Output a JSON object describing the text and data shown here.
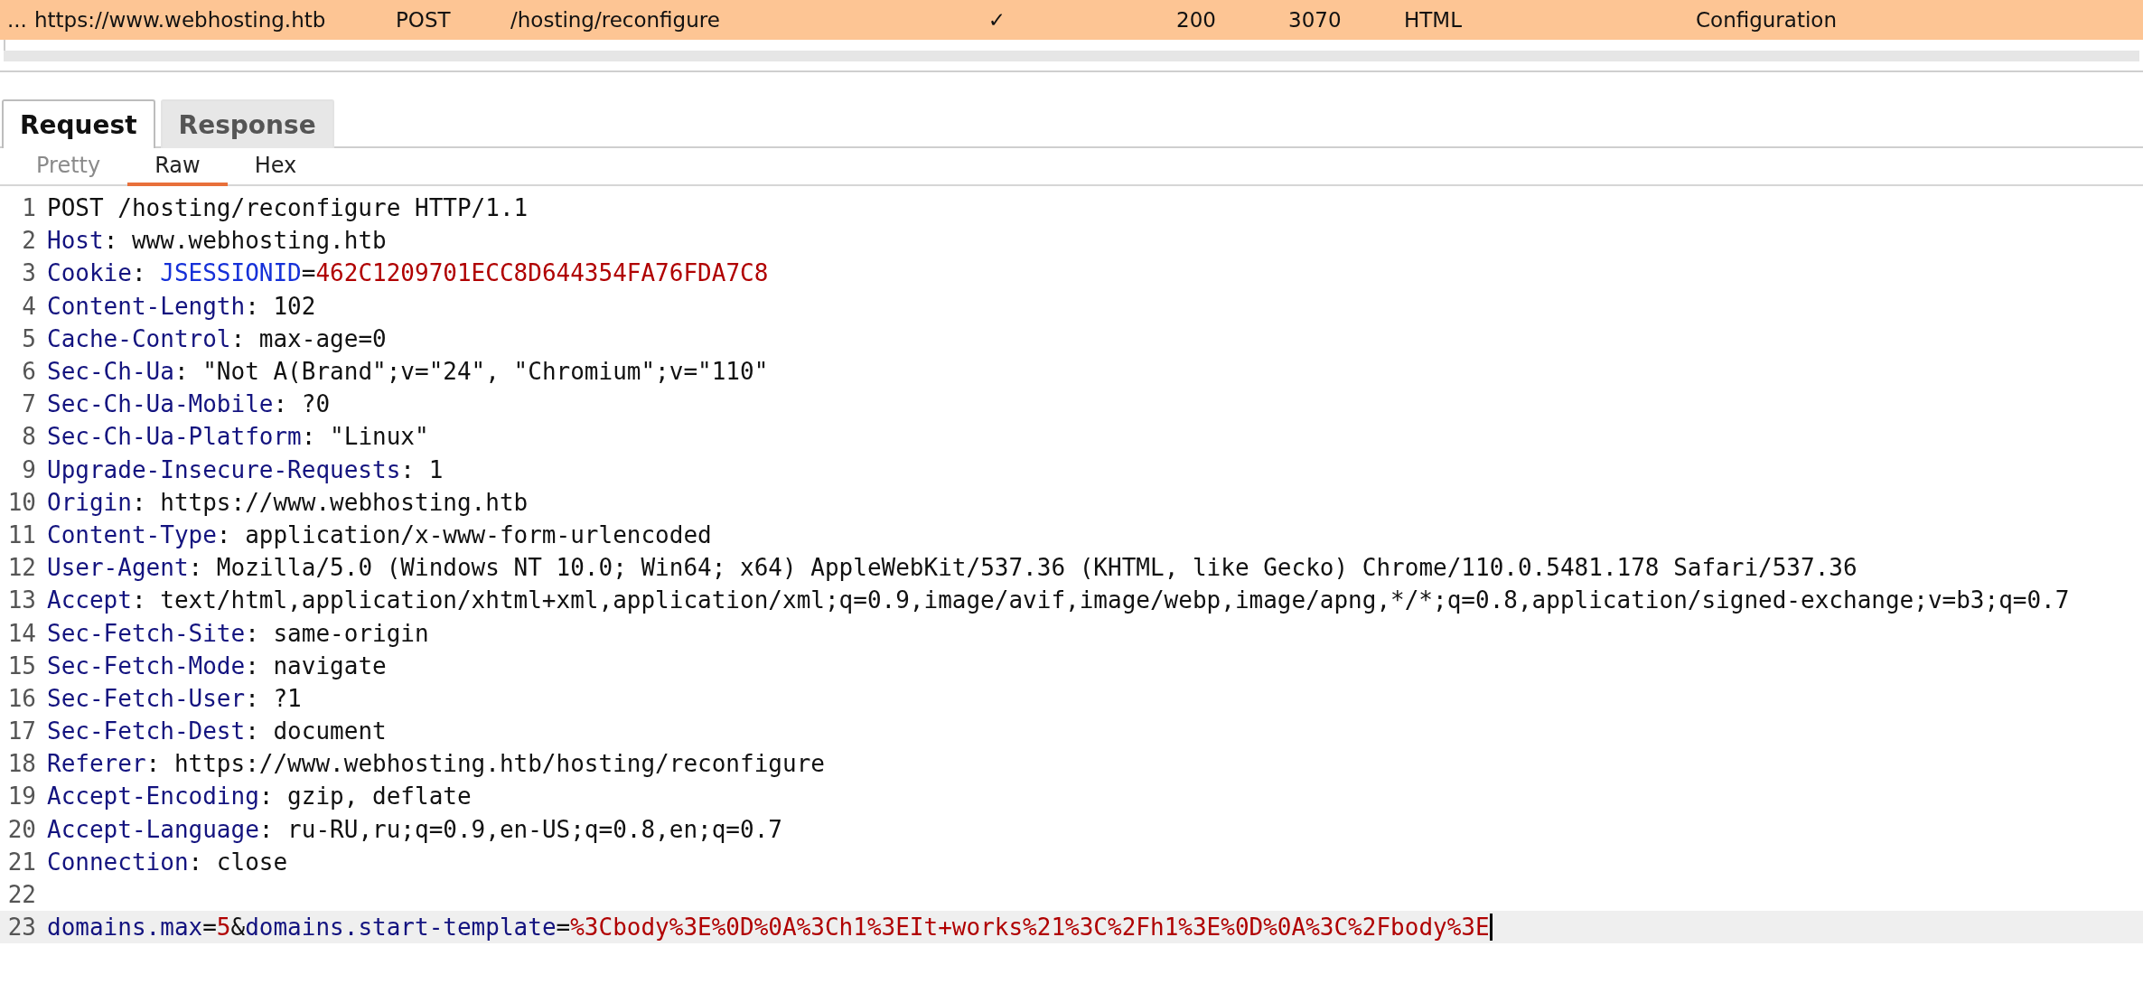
{
  "history_table": {
    "rows": [
      {
        "selected": true,
        "cells": [
          "...",
          "https://www.webhosting.htb",
          "POST",
          "/hosting/reconfigure",
          "✓",
          "200",
          "3070",
          "HTML",
          "Configuration"
        ]
      }
    ]
  },
  "message_tabs": [
    {
      "label": "Request",
      "selected": true
    },
    {
      "label": "Response",
      "selected": false
    }
  ],
  "view_tabs": [
    {
      "label": "Pretty",
      "selected": false,
      "disabled": true
    },
    {
      "label": "Raw",
      "selected": true,
      "disabled": false
    },
    {
      "label": "Hex",
      "selected": false,
      "disabled": false
    }
  ],
  "editor": {
    "lines": [
      {
        "number": "1",
        "active": false,
        "segments": [
          {
            "kind": "plain",
            "text": "POST /hosting/reconfigure HTTP/1.1"
          }
        ]
      },
      {
        "number": "2",
        "active": false,
        "segments": [
          {
            "kind": "header",
            "text": "Host"
          },
          {
            "kind": "plain",
            "text": ": www.webhosting.htb"
          }
        ]
      },
      {
        "number": "3",
        "active": false,
        "segments": [
          {
            "kind": "header",
            "text": "Cookie"
          },
          {
            "kind": "plain",
            "text": ": "
          },
          {
            "kind": "param",
            "text": "JSESSIONID"
          },
          {
            "kind": "plain",
            "text": "="
          },
          {
            "kind": "value",
            "text": "462C1209701ECC8D644354FA76FDA7C8"
          }
        ]
      },
      {
        "number": "4",
        "active": false,
        "segments": [
          {
            "kind": "header",
            "text": "Content-Length"
          },
          {
            "kind": "plain",
            "text": ": 102"
          }
        ]
      },
      {
        "number": "5",
        "active": false,
        "segments": [
          {
            "kind": "header",
            "text": "Cache-Control"
          },
          {
            "kind": "plain",
            "text": ": max-age=0"
          }
        ]
      },
      {
        "number": "6",
        "active": false,
        "segments": [
          {
            "kind": "header",
            "text": "Sec-Ch-Ua"
          },
          {
            "kind": "plain",
            "text": ": \"Not A(Brand\";v=\"24\", \"Chromium\";v=\"110\""
          }
        ]
      },
      {
        "number": "7",
        "active": false,
        "segments": [
          {
            "kind": "header",
            "text": "Sec-Ch-Ua-Mobile"
          },
          {
            "kind": "plain",
            "text": ": ?0"
          }
        ]
      },
      {
        "number": "8",
        "active": false,
        "segments": [
          {
            "kind": "header",
            "text": "Sec-Ch-Ua-Platform"
          },
          {
            "kind": "plain",
            "text": ": \"Linux\""
          }
        ]
      },
      {
        "number": "9",
        "active": false,
        "segments": [
          {
            "kind": "header",
            "text": "Upgrade-Insecure-Requests"
          },
          {
            "kind": "plain",
            "text": ": 1"
          }
        ]
      },
      {
        "number": "10",
        "active": false,
        "segments": [
          {
            "kind": "header",
            "text": "Origin"
          },
          {
            "kind": "plain",
            "text": ": https://www.webhosting.htb"
          }
        ]
      },
      {
        "number": "11",
        "active": false,
        "segments": [
          {
            "kind": "header",
            "text": "Content-Type"
          },
          {
            "kind": "plain",
            "text": ": application/x-www-form-urlencoded"
          }
        ]
      },
      {
        "number": "12",
        "active": false,
        "segments": [
          {
            "kind": "header",
            "text": "User-Agent"
          },
          {
            "kind": "plain",
            "text": ": Mozilla/5.0 (Windows NT 10.0; Win64; x64) AppleWebKit/537.36 (KHTML, like Gecko) Chrome/110.0.5481.178 Safari/537.36"
          }
        ]
      },
      {
        "number": "13",
        "active": false,
        "segments": [
          {
            "kind": "header",
            "text": "Accept"
          },
          {
            "kind": "plain",
            "text": ": text/html,application/xhtml+xml,application/xml;q=0.9,image/avif,image/webp,image/apng,*/*;q=0.8,application/signed-exchange;v=b3;q=0.7"
          }
        ]
      },
      {
        "number": "14",
        "active": false,
        "segments": [
          {
            "kind": "header",
            "text": "Sec-Fetch-Site"
          },
          {
            "kind": "plain",
            "text": ": same-origin"
          }
        ]
      },
      {
        "number": "15",
        "active": false,
        "segments": [
          {
            "kind": "header",
            "text": "Sec-Fetch-Mode"
          },
          {
            "kind": "plain",
            "text": ": navigate"
          }
        ]
      },
      {
        "number": "16",
        "active": false,
        "segments": [
          {
            "kind": "header",
            "text": "Sec-Fetch-User"
          },
          {
            "kind": "plain",
            "text": ": ?1"
          }
        ]
      },
      {
        "number": "17",
        "active": false,
        "segments": [
          {
            "kind": "header",
            "text": "Sec-Fetch-Dest"
          },
          {
            "kind": "plain",
            "text": ": document"
          }
        ]
      },
      {
        "number": "18",
        "active": false,
        "segments": [
          {
            "kind": "header",
            "text": "Referer"
          },
          {
            "kind": "plain",
            "text": ": https://www.webhosting.htb/hosting/reconfigure"
          }
        ]
      },
      {
        "number": "19",
        "active": false,
        "segments": [
          {
            "kind": "header",
            "text": "Accept-Encoding"
          },
          {
            "kind": "plain",
            "text": ": gzip, deflate"
          }
        ]
      },
      {
        "number": "20",
        "active": false,
        "segments": [
          {
            "kind": "header",
            "text": "Accept-Language"
          },
          {
            "kind": "plain",
            "text": ": ru-RU,ru;q=0.9,en-US;q=0.8,en;q=0.7"
          }
        ]
      },
      {
        "number": "21",
        "active": false,
        "segments": [
          {
            "kind": "header",
            "text": "Connection"
          },
          {
            "kind": "plain",
            "text": ": close"
          }
        ]
      },
      {
        "number": "22",
        "active": false
      },
      {
        "number": "23",
        "active": true,
        "segments": [
          {
            "kind": "header",
            "text": "domains.max"
          },
          {
            "kind": "plain",
            "text": "="
          },
          {
            "kind": "value",
            "text": "5"
          },
          {
            "kind": "plain",
            "text": "&"
          },
          {
            "kind": "header",
            "text": "domains.start-template"
          },
          {
            "kind": "plain",
            "text": "="
          },
          {
            "kind": "value",
            "text": "%3Cbody%3E%0D%0A%3Ch1%3EIt+works%21%3C%2Fh1%3E%0D%0A%3C%2Fbody%3E"
          }
        ]
      }
    ]
  }
}
